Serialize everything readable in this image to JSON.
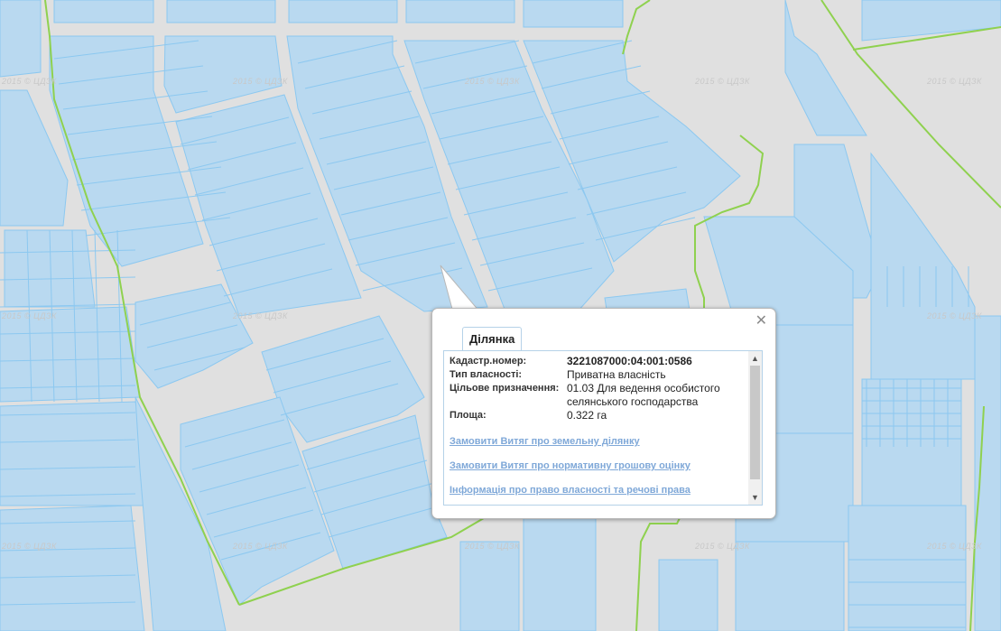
{
  "watermark_text": "2015 © ЦДЗК",
  "colors": {
    "background": "#e0e0e0",
    "parcel_fill": "#b9d9f0",
    "parcel_stroke": "#8cc8f0",
    "boundary": "#8fd14f"
  },
  "popup": {
    "tab_label": "Ділянка",
    "fields": [
      {
        "label": "Кадастр.номер:",
        "value": "3221087000:04:001:0586",
        "bold": true
      },
      {
        "label": "Тип власності:",
        "value": "Приватна власність",
        "bold": false
      },
      {
        "label": "Цільове призначення:",
        "value": "01.03 Для ведення особистого селянського господарства",
        "bold": false
      },
      {
        "label": "Площа:",
        "value": "0.322 га",
        "bold": false
      }
    ],
    "links": [
      "Замовити Витяг про земельну ділянку",
      "Замовити Витяг про нормативну грошову оцінку",
      "Інформація про право власності та речові права"
    ]
  }
}
